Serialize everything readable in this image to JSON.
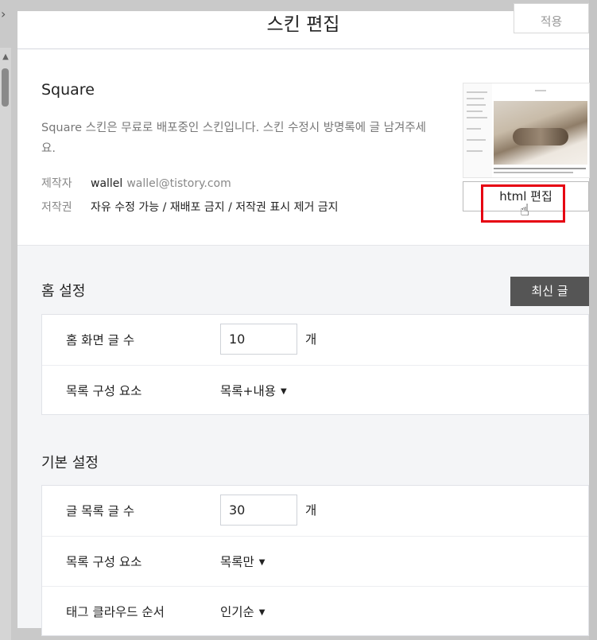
{
  "header": {
    "title": "스킨 편집",
    "apply_label": "적용"
  },
  "skin": {
    "name": "Square",
    "description": "Square 스킨은 무료로 배포중인 스킨입니다. 스킨 수정시 방명록에 글 남겨주세요.",
    "author_key": "제작자",
    "author_name": "wallel",
    "author_email": "wallel@tistory.com",
    "license_key": "저작권",
    "license_value": "자유 수정 가능 / 재배포 금지 / 저작권 표시 제거 금지",
    "html_edit_label": "html 편집"
  },
  "home": {
    "title": "홈 설정",
    "recent_label": "최신 글",
    "rows": [
      {
        "label": "홈 화면 글 수",
        "value": "10",
        "unit": "개"
      },
      {
        "label": "목록 구성 요소",
        "value": "목록+내용"
      }
    ]
  },
  "basic": {
    "title": "기본 설정",
    "rows": [
      {
        "label": "글 목록 글 수",
        "value": "30",
        "unit": "개"
      },
      {
        "label": "목록 구성 요소",
        "value": "목록만"
      },
      {
        "label": "태그 클라우드 순서",
        "value": "인기순"
      }
    ]
  },
  "colors": {
    "highlight": "#e60012",
    "dark_button": "#555555",
    "panel_bg": "#f4f5f7"
  }
}
